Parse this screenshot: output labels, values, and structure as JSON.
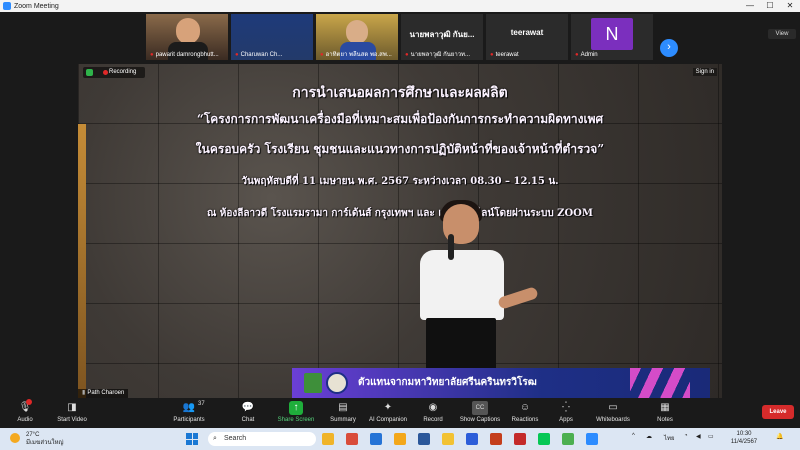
{
  "window": {
    "title": "Zoom Meeting",
    "min": "—",
    "max": "☐",
    "close": "✕"
  },
  "strip": {
    "tiles": [
      {
        "name": "pawarit damrongbhutt..."
      },
      {
        "name": "Charuwan Ch..."
      },
      {
        "name": "อาทิตยา พลีนสด พอ.สพ..."
      },
      {
        "name": "นายพลาวุฒิ กันยาวท...",
        "big": "นายพลาวุฒิ กันย..."
      },
      {
        "name": "teerawat",
        "big": "teerawat"
      },
      {
        "name": "Admin",
        "big": "N"
      }
    ],
    "view_label": "View",
    "next_arrow": "›"
  },
  "share": {
    "recording_label": "Recording",
    "signin_label": "Sign in",
    "banner": {
      "line1": "การนำเสนอผลการศึกษาและผลผลิต",
      "line2": "“โครงการการพัฒนาเครื่องมือที่เหมาะสมเพื่อป้องกันการกระทำความผิดทางเพศ",
      "line3": "ในครอบครัว โรงเรียน ชุมชนและแนวทางการปฏิบัติหน้าที่ของเจ้าหน้าที่ตำรวจ”",
      "line4": "วันพฤหัสบดีที่ 11 เมษายน พ.ศ. 2567 ระหว่างเวลา 08.30 – 12.15 น.",
      "line5": "ณ ห้องลีลาวดี โรงแรมรามา การ์เด้นส์ กรุงเทพฯ และ  แบบออนไลน์โดยผ่านระบบ ZOOM"
    },
    "lower_third": "ตัวแทนจากมหาวิทยาลัยศรีนครินทรวิโรฒ",
    "speaker_name": "Path Charoen"
  },
  "toolbar": {
    "audio": "Audio",
    "video": "Start Video",
    "participants": "Participants",
    "participants_count": "37",
    "chat": "Chat",
    "share": "Share Screen",
    "summary": "Summary",
    "companion": "AI Companion",
    "record": "Record",
    "captions": "Show Captions",
    "reactions": "Reactions",
    "apps": "Apps",
    "whiteboards": "Whiteboards",
    "notes": "Notes",
    "leave": "Leave",
    "cc_icon": "CC"
  },
  "taskbar": {
    "temp": "27°C",
    "weather_text": "มีเมฆส่วนใหญ่",
    "search_placeholder": "Search",
    "lang": "ไทย",
    "time": "10:30",
    "date": "11/4/2567"
  },
  "colors": {
    "accent": "#2d8cff",
    "record_red": "#e02828",
    "share_green": "#1fae3b",
    "leave_red": "#d52b2b",
    "lower_third_purple": "#6b3fd6"
  }
}
